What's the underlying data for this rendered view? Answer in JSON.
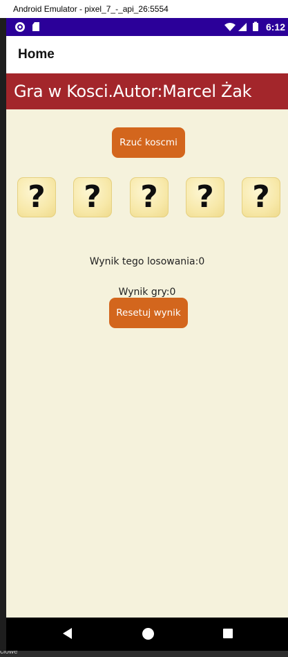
{
  "window": {
    "title": "Android Emulator - pixel_7_-_api_26:5554"
  },
  "status_bar": {
    "time": "6:12",
    "icons": [
      "record-icon",
      "sd-card-icon",
      "wifi-icon",
      "signal-icon",
      "battery-icon"
    ],
    "background": "#2b0099"
  },
  "app_bar": {
    "title": "Home"
  },
  "banner": {
    "text": "Gra w Kosci.Autor:Marcel Żak",
    "color": "#a3262b"
  },
  "roll_button": {
    "label": "Rzuć koscmi"
  },
  "dice": [
    {
      "face": "?"
    },
    {
      "face": "?"
    },
    {
      "face": "?"
    },
    {
      "face": "?"
    },
    {
      "face": "?"
    }
  ],
  "scores": {
    "round": "Wynik tego losowania:0",
    "game": "Wynik gry:0"
  },
  "reset_button": {
    "label": "Resetuj wynik"
  },
  "colors": {
    "accent_button": "#d3661d",
    "content_background": "#f5f2dc"
  },
  "taskbar": {
    "text": "ciowe"
  }
}
